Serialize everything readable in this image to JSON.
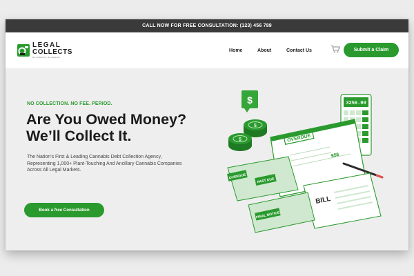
{
  "topbar": {
    "text": "CALL NOW FOR FREE CONSULTATION:  (123) 456 789"
  },
  "logo": {
    "line1": "LEGAL",
    "line2": "COLLECTS",
    "tagline": "No collection, No expense"
  },
  "nav": {
    "items": [
      "Home",
      "About",
      "Contact Us"
    ]
  },
  "header": {
    "cta_label": "Submit a Claim"
  },
  "hero": {
    "tagline": "NO COLLECTION. NO FEE. PERIOD.",
    "headline_line1": "Are You Owed Money?",
    "headline_line2": "We’ll Collect It.",
    "description": "The Nation's First & Leading Cannabis Debt Collection Agency, Representing 1,000+  Plant-Touching And Ancillary Cannabis Companies Across All Legal Markets.",
    "cta_label": "Book a free Consultation"
  },
  "illustration": {
    "calculator_display": "3256.90",
    "labels": {
      "overdue": "OVERDUE",
      "past_due": "PAST DUE",
      "final_notice": "FINAL NOTICE",
      "overdue_small": "OVERDUE",
      "bill": "BILL",
      "amount": "$$$"
    }
  },
  "colors": {
    "brand_green": "#2a9a2e",
    "topbar": "#3a3a3a",
    "light_green": "#cfe8cf"
  },
  "icons": [
    "logo-mark-icon",
    "cart-icon",
    "dollar-bubble-icon",
    "coin-stack-icon",
    "calculator-icon",
    "pen-icon"
  ]
}
